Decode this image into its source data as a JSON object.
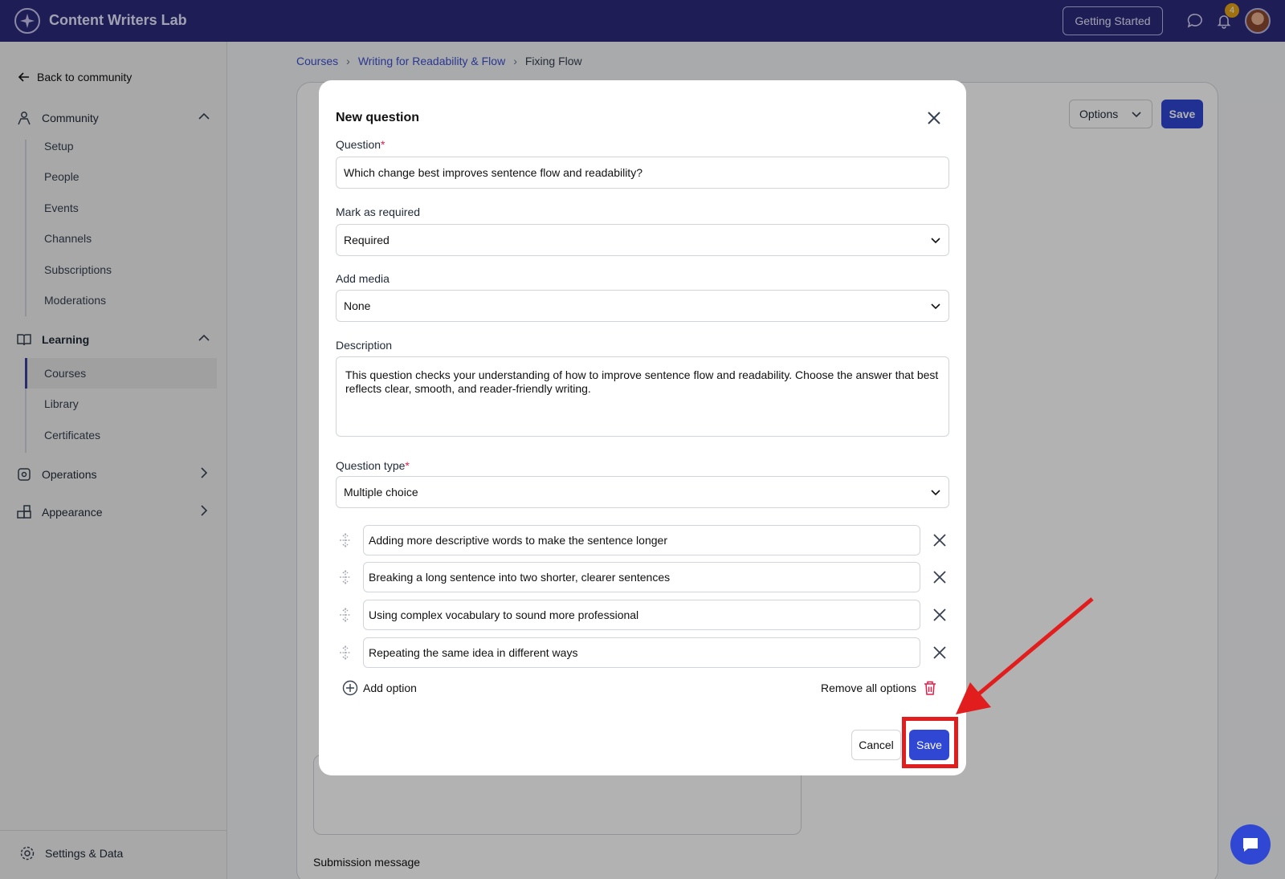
{
  "app": {
    "brand": "Content Writers Lab",
    "getting_started": "Getting Started",
    "notifications_count": "4"
  },
  "sidebar": {
    "back": "Back to community",
    "community": {
      "label": "Community",
      "items": [
        "Setup",
        "People",
        "Events",
        "Channels",
        "Subscriptions",
        "Moderations"
      ]
    },
    "learning": {
      "label": "Learning",
      "items": [
        "Courses",
        "Library",
        "Certificates"
      ],
      "active": "Courses"
    },
    "operations": "Operations",
    "appearance": "Appearance",
    "settings": "Settings & Data"
  },
  "breadcrumb": [
    "Courses",
    "Writing for Readability & Flow",
    "Fixing Flow"
  ],
  "page": {
    "options_label": "Options",
    "save_label": "Save",
    "submission_message_label": "Submission message"
  },
  "modal": {
    "title": "New question",
    "question_label": "Question",
    "question_value": "Which change best improves sentence flow and readability?",
    "mark_required_label": "Mark as required",
    "mark_required_value": "Required",
    "add_media_label": "Add media",
    "add_media_value": "None",
    "description_label": "Description",
    "description_value": "This question checks your understanding of how to improve sentence flow and readability. Choose the answer that best reflects clear, smooth, and reader-friendly writing.",
    "question_type_label": "Question type",
    "question_type_value": "Multiple choice",
    "options": [
      "Adding more descriptive words to make the sentence longer",
      "Breaking a long sentence into two shorter, clearer sentences",
      "Using complex vocabulary to sound more professional",
      "Repeating the same idea in different ways"
    ],
    "add_option": "Add option",
    "remove_all_options": "Remove all options",
    "cancel": "Cancel",
    "save": "Save"
  },
  "colors": {
    "topbar": "#2d2a7a",
    "primary": "#2f47d3",
    "annotation": "#e11d1d",
    "required": "#e11d48"
  }
}
